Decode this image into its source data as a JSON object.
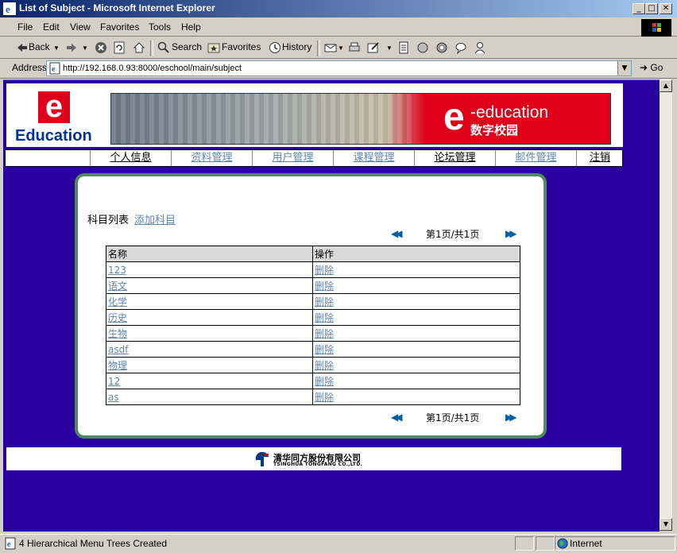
{
  "window": {
    "title": "List of Subject - Microsoft Internet Explorer",
    "minimize": "_",
    "maximize": "□",
    "close": "✕"
  },
  "menubar": {
    "items": [
      "File",
      "Edit",
      "View",
      "Favorites",
      "Tools",
      "Help"
    ]
  },
  "toolbar": {
    "back": "Back",
    "search": "Search",
    "favorites": "Favorites",
    "history": "History"
  },
  "address": {
    "label": "Address",
    "url": "http://192.168.0.93:8000/eschool/main/subject",
    "go": "Go"
  },
  "header": {
    "logo_letter": "e",
    "logo_text": "Education",
    "banner_e": "e",
    "banner_title": "-education",
    "banner_subtitle": "数字校园"
  },
  "nav": {
    "items": [
      {
        "label": "个人信息",
        "style": "dark"
      },
      {
        "label": "资料管理",
        "style": "light"
      },
      {
        "label": "用户管理",
        "style": "light"
      },
      {
        "label": "课程管理",
        "style": "light"
      },
      {
        "label": "论坛管理",
        "style": "dark"
      },
      {
        "label": "邮件管理",
        "style": "light"
      },
      {
        "label": "注销",
        "style": "dark"
      }
    ]
  },
  "content": {
    "title": "科目列表",
    "add_link": "添加科目",
    "pager_text": "第1页/共1页",
    "prev_icon": "◀◀",
    "next_icon": "▶▶",
    "columns": [
      "名称",
      "操作"
    ],
    "rows": [
      {
        "name": "123",
        "action": "删除"
      },
      {
        "name": "语文",
        "action": "删除"
      },
      {
        "name": "化学",
        "action": "删除"
      },
      {
        "name": "历史",
        "action": "删除"
      },
      {
        "name": "生物",
        "action": "删除"
      },
      {
        "name": "asdf",
        "action": "删除"
      },
      {
        "name": "物理",
        "action": "删除"
      },
      {
        "name": "12",
        "action": "删除"
      },
      {
        "name": "as",
        "action": "删除"
      }
    ]
  },
  "footer": {
    "company_cn": "清华同方股份有限公司",
    "company_en": "TSINGHUA TONGFANG CO.,LTD."
  },
  "statusbar": {
    "text": "4 Hierarchical Menu Trees Created",
    "zone": "Internet"
  },
  "colors": {
    "page_bg": "#2a00a0",
    "panel_border": "#4e8a5e",
    "link": "#5f86b3",
    "brand_red": "#e0001a"
  }
}
